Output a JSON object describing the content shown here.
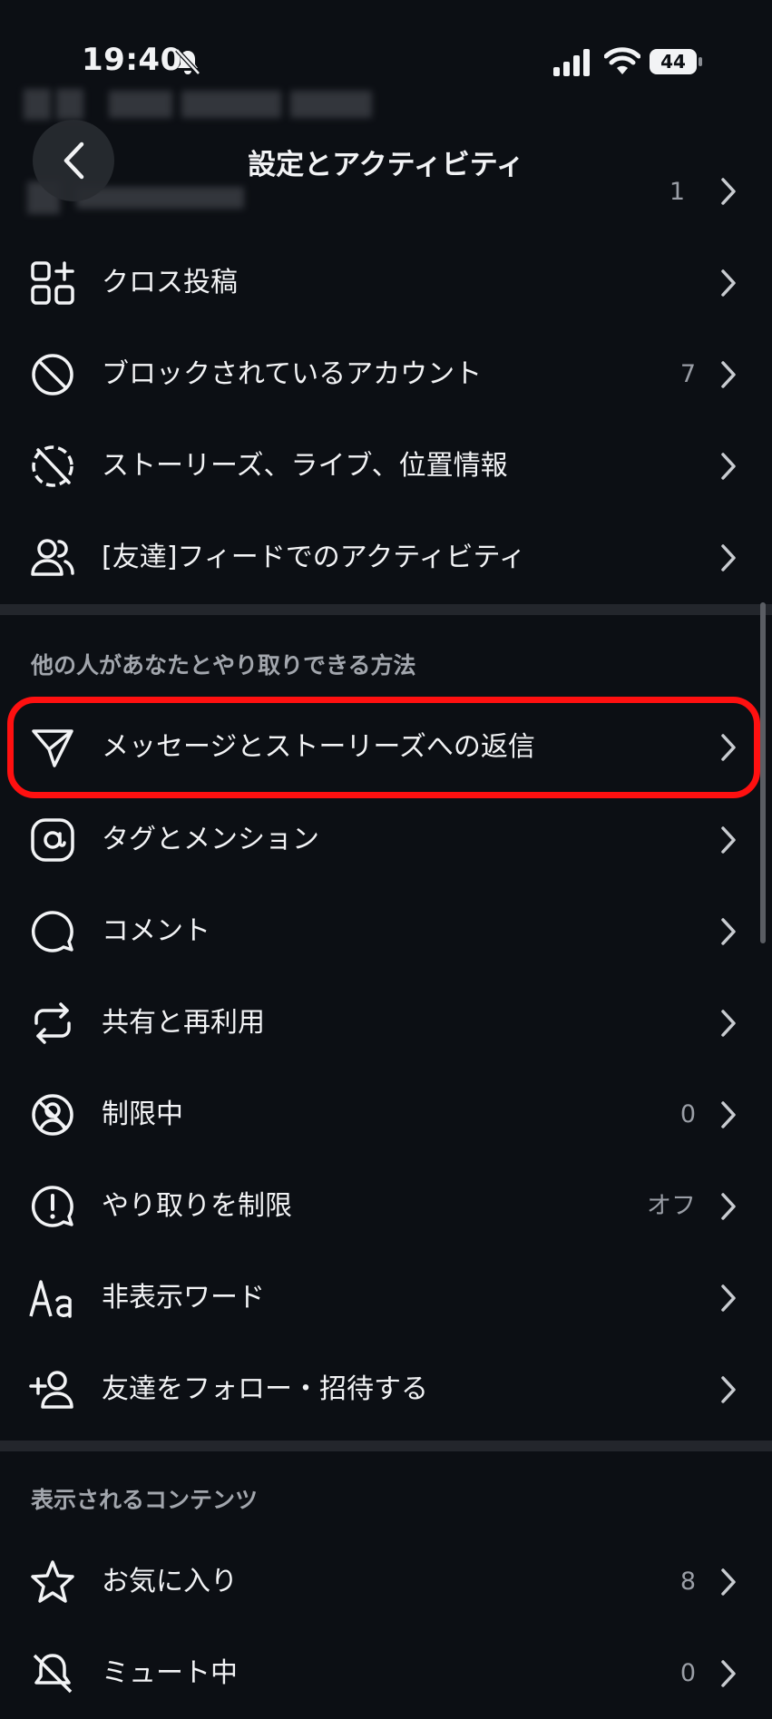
{
  "status": {
    "time": "19:40",
    "battery": "44"
  },
  "header": {
    "title": "設定とアクティビティ",
    "top_row_count": "1"
  },
  "rows_top": [
    {
      "label": "クロス投稿",
      "value": "",
      "icon": "cross-post-icon"
    },
    {
      "label": "ブロックされているアカウント",
      "value": "7",
      "icon": "block-icon"
    },
    {
      "label": "ストーリーズ、ライブ、位置情報",
      "value": "",
      "icon": "story-hide-icon"
    },
    {
      "label": "[友達]フィードでのアクティビティ",
      "value": "",
      "icon": "people-icon"
    }
  ],
  "section_interactions": {
    "title": "他の人があなたとやり取りできる方法",
    "rows": [
      {
        "label": "メッセージとストーリーズへの返信",
        "value": "",
        "icon": "send-icon"
      },
      {
        "label": "タグとメンション",
        "value": "",
        "icon": "at-icon"
      },
      {
        "label": "コメント",
        "value": "",
        "icon": "comment-icon"
      },
      {
        "label": "共有と再利用",
        "value": "",
        "icon": "repost-icon"
      },
      {
        "label": "制限中",
        "value": "0",
        "icon": "restricted-icon"
      },
      {
        "label": "やり取りを制限",
        "value": "オフ",
        "icon": "limit-icon"
      },
      {
        "label": "非表示ワード",
        "value": "",
        "icon": "text-aa-icon"
      },
      {
        "label": "友達をフォロー・招待する",
        "value": "",
        "icon": "add-person-icon"
      }
    ]
  },
  "section_content": {
    "title": "表示されるコンテンツ",
    "rows": [
      {
        "label": "お気に入り",
        "value": "8",
        "icon": "star-icon"
      },
      {
        "label": "ミュート中",
        "value": "0",
        "icon": "mute-icon"
      }
    ]
  },
  "colors": {
    "background": "#0c0f14",
    "text": "#f2f3f5",
    "muted": "#9a9ea6",
    "divider": "#23262c",
    "highlight": "#ff1010"
  }
}
